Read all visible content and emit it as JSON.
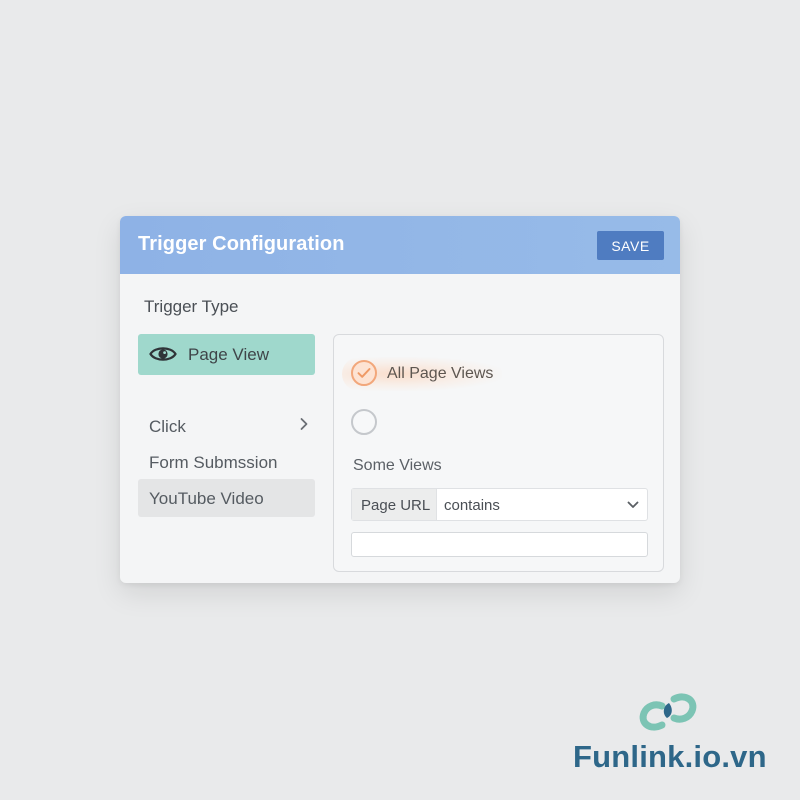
{
  "header": {
    "title": "Trigger Configuration",
    "save_label": "SAVE"
  },
  "trigger_types": {
    "label": "Trigger Type",
    "items": [
      {
        "label": "Page View",
        "icon": "eye-icon",
        "selected": true
      },
      {
        "label": "Click",
        "icon": "chevron-right-icon",
        "selected": false
      },
      {
        "label": "Form Submssion",
        "selected": false
      },
      {
        "label": "YouTube Video",
        "selected": false,
        "highlighted": true
      }
    ]
  },
  "options": {
    "all_label": "All Page Views",
    "all_checked": true,
    "some_checked": false,
    "some_label": "Some Views",
    "condition": {
      "field": "Page URL",
      "operator": "contains",
      "value": ""
    }
  },
  "logo": {
    "text": "Funlink.io.vn"
  },
  "colors": {
    "header": "#8eb2e6",
    "save_button": "#4f7cc1",
    "selected_item": "#9fd8cc",
    "radio_accent": "#f2a77b",
    "logo_text": "#2e6789",
    "logo_mark": "#7cc4b4"
  }
}
